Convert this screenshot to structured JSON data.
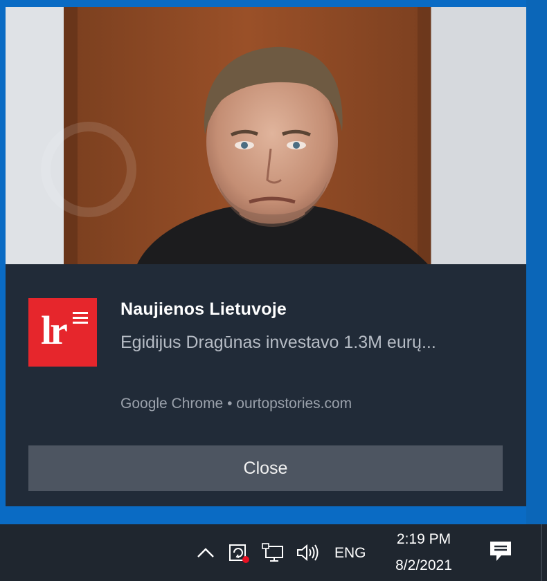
{
  "notification": {
    "title": "Naujienos Lietuvoje",
    "message": "Egidijus Dragūnas investavo 1.3M eurų...",
    "attribution": "Google Chrome • ourtopstories.com",
    "close_label": "Close",
    "logo_text": "lr",
    "logo_color": "#e6262c",
    "background_color": "#212b38"
  },
  "taskbar": {
    "language": "ENG",
    "time": "2:19 PM",
    "date": "8/2/2021",
    "tray_icons": [
      "chevron-up-icon",
      "security-center-icon",
      "network-icon",
      "volume-icon",
      "action-center-icon"
    ]
  },
  "colors": {
    "desktop": "#0a6bc4",
    "taskbar": "#1f262f",
    "button": "#4d5561"
  }
}
